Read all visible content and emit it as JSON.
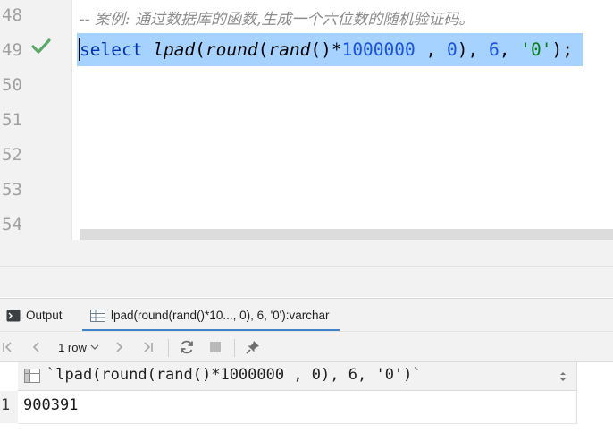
{
  "editor": {
    "line_numbers": [
      "48",
      "49",
      "50",
      "51",
      "52",
      "53",
      "54"
    ],
    "comment_line": "-- 案例: 通过数据库的函数,生成一个六位数的随机验证码。",
    "code_tokens": {
      "select": "select",
      "space1": " ",
      "lpad": "lpad",
      "paren1": "(",
      "round": "round",
      "paren2": "(",
      "rand": "rand",
      "paren3": "()*",
      "num1": "1000000",
      "comma1": " , ",
      "num0": "0",
      "close1": "), ",
      "num6": "6",
      "comma2": ", ",
      "str0": "'0'",
      "end": ");"
    }
  },
  "tabs": {
    "output_label": "Output",
    "result_label": "lpad(round(rand()*10..., 0), 6, '0'):varchar"
  },
  "toolbar": {
    "row_count": "1 row"
  },
  "grid": {
    "column_header": "`lpad(round(rand()*1000000 , 0), 6, '0')`",
    "rows": [
      {
        "num": "1",
        "value": "900391"
      }
    ]
  },
  "colors": {
    "selection": "#a6d2ff",
    "keyword": "#0033b3",
    "number": "#1750eb",
    "string": "#067d17",
    "check": "#59a869"
  }
}
